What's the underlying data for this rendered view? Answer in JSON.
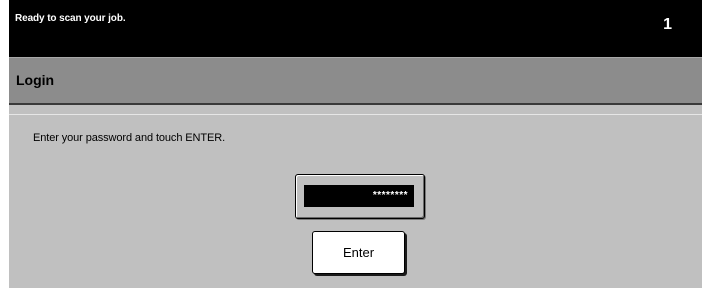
{
  "status_bar": {
    "message": "Ready to scan your job.",
    "job_count": "1"
  },
  "title_bar": {
    "title": "Login"
  },
  "content": {
    "instruction": "Enter your password and touch ENTER.",
    "password_value": "********",
    "enter_label": "Enter"
  },
  "colors": {
    "status_bar_bg": "#000000",
    "title_bar_bg": "#8c8c8c",
    "panel_bg": "#c0c0c0",
    "button_bg": "#ffffff"
  }
}
